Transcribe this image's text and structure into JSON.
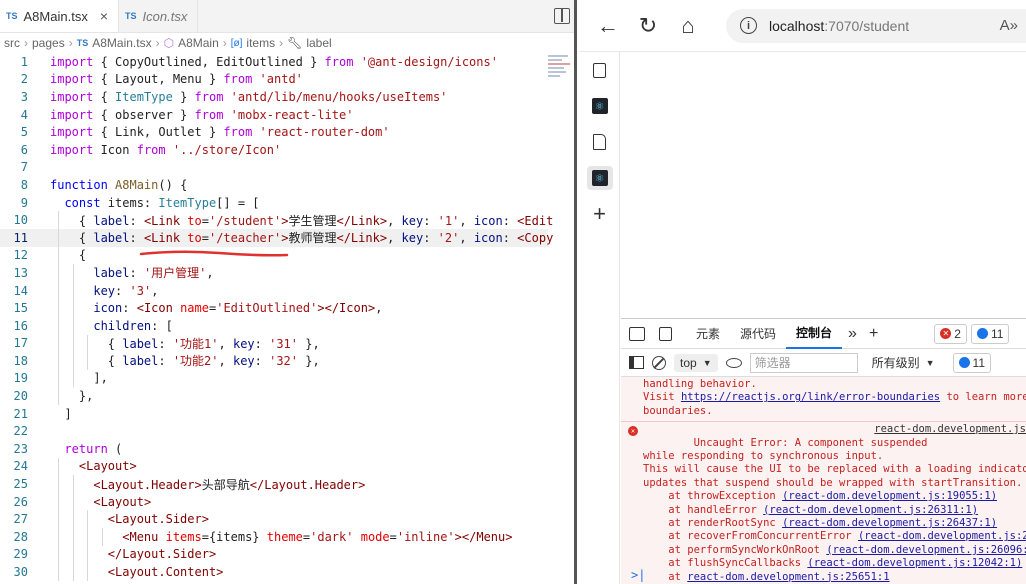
{
  "editor": {
    "tabs": [
      {
        "icon": "TS",
        "name": "A8Main.tsx",
        "close": "×",
        "active": true
      },
      {
        "icon": "TS",
        "name": "Icon.tsx",
        "active": false
      }
    ],
    "breadcrumb": [
      "src",
      "pages",
      "A8Main.tsx",
      "A8Main",
      "items",
      "label"
    ],
    "current_line": 11,
    "lines": [
      "import { CopyOutlined, EditOutlined } from '@ant-design/icons'",
      "import { Layout, Menu } from 'antd'",
      "import { ItemType } from 'antd/lib/menu/hooks/useItems'",
      "import { observer } from 'mobx-react-lite'",
      "import { Link, Outlet } from 'react-router-dom'",
      "import Icon from '../store/Icon'",
      "",
      "function A8Main() {",
      "  const items: ItemType[] = [",
      "    { label: <Link to='/student'>学生管理</Link>, key: '1', icon: <Edit",
      "    { label: <Link to='/teacher'>教师管理</Link>, key: '2', icon: <Copy",
      "    {",
      "      label: '用户管理',",
      "      key: '3',",
      "      icon: <Icon name='EditOutlined'></Icon>,",
      "      children: [",
      "        { label: '功能1', key: '31' },",
      "        { label: '功能2', key: '32' },",
      "      ],",
      "    },",
      "  ]",
      "",
      "  return (",
      "    <Layout>",
      "      <Layout.Header>头部导航</Layout.Header>",
      "      <Layout>",
      "        <Layout.Sider>",
      "          <Menu items={items} theme='dark' mode='inline'></Menu>",
      "        </Layout.Sider>",
      "        <Layout.Content>"
    ]
  },
  "browser": {
    "url_host": "localhost",
    "url_rest": ":7070/student",
    "read_aloud": "A»"
  },
  "devtools": {
    "tabs": [
      "元素",
      "源代码",
      "控制台"
    ],
    "active_tab": "控制台",
    "error_count": "2",
    "info_count": "11",
    "context": "top",
    "filter_placeholder": "筛选器",
    "levels": "所有级别",
    "levels_count": "11",
    "console_lines": [
      "handling behavior.",
      "Visit https://reactjs.org/link/error-boundaries to learn more a",
      "boundaries."
    ],
    "error": {
      "head": "Uncaught Error: A component suspended",
      "head_src": "react-dom.development.js",
      "body": [
        "while responding to synchronous input.",
        "This will cause the UI to be replaced with a loading indicator.",
        "updates that suspend should be wrapped with startTransition."
      ],
      "stack": [
        {
          "fn": "at throwException",
          "loc": "(react-dom.development.js:19055:1)"
        },
        {
          "fn": "at handleError",
          "loc": "(react-dom.development.js:26311:1)"
        },
        {
          "fn": "at renderRootSync",
          "loc": "(react-dom.development.js:26437:1)"
        },
        {
          "fn": "at recoverFromConcurrentError",
          "loc": "(react-dom.development.js:25"
        },
        {
          "fn": "at performSyncWorkOnRoot",
          "loc": "(react-dom.development.js:26096:1)"
        },
        {
          "fn": "at flushSyncCallbacks",
          "loc": "(react-dom.development.js:12042:1)"
        },
        {
          "fn": "at",
          "loc": "react-dom.development.js:25651:1"
        }
      ]
    },
    "prompt": ">|"
  }
}
